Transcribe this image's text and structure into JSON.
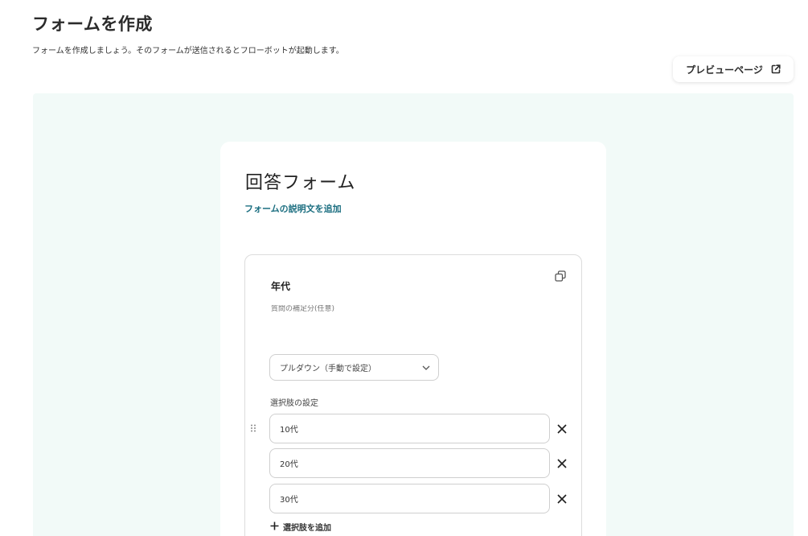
{
  "header": {
    "title": "フォームを作成",
    "description": "フォームを作成しましょう。そのフォームが送信されるとフローボットが起動します。",
    "preview_label": "プレビューページ"
  },
  "form": {
    "title": "回答フォーム",
    "add_description_label": "フォームの説明文を追加",
    "question": {
      "title": "年代",
      "hint_placeholder": "質問の補足分(任意)",
      "type_value": "プルダウン（手動で設定）",
      "options_label": "選択肢の設定",
      "options": [
        "10代",
        "20代",
        "30代"
      ],
      "add_option_label": "選択肢を追加"
    }
  },
  "icons": {
    "preview": "external-link-icon",
    "copy": "copy-icon",
    "dropdown": "chevron-down-icon",
    "drag": "drag-handle-icon",
    "remove": "close-icon",
    "add": "plus-icon"
  }
}
